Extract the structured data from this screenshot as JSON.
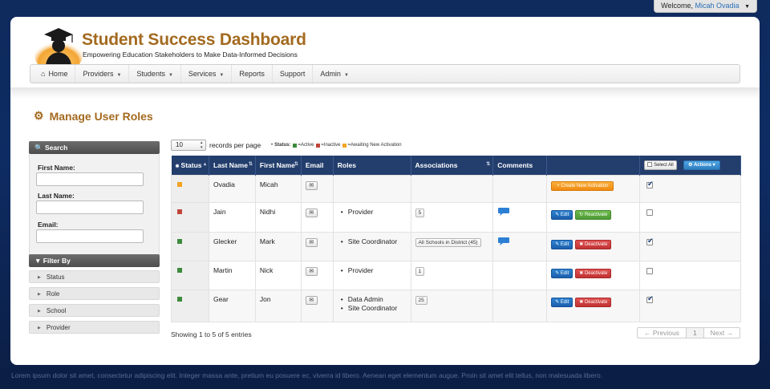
{
  "welcome": {
    "prefix": "Welcome,",
    "user": "Micah Ovadia"
  },
  "header": {
    "title": "Student Success Dashboard",
    "subtitle": "Empowering Education Stakeholders to Make Data-Informed Decisions"
  },
  "nav": {
    "home": "Home",
    "providers": "Providers",
    "students": "Students",
    "services": "Services",
    "reports": "Reports",
    "support": "Support",
    "admin": "Admin"
  },
  "page": {
    "title": "Manage User Roles"
  },
  "search": {
    "title": "Search",
    "first_name_label": "First Name:",
    "last_name_label": "Last Name:",
    "email_label": "Email:",
    "first_name_value": "",
    "last_name_value": "",
    "email_value": ""
  },
  "filter": {
    "title": "Filter By",
    "items": [
      "Status",
      "Role",
      "School",
      "Provider"
    ]
  },
  "controls": {
    "records_value": "10",
    "records_label": "records per page",
    "status_label": "Status:",
    "active_label": "=Active",
    "inactive_label": "=Inactive",
    "awaiting_label": "=Awaiting New Activation"
  },
  "colors": {
    "active": "#3c8a3c",
    "inactive": "#c0463a",
    "awaiting": "#f5a322",
    "accent": "#a36a1f",
    "header_bg": "#233e6d"
  },
  "table": {
    "headers": {
      "status": "Status",
      "last_name": "Last Name",
      "first_name": "First Name",
      "email": "Email",
      "roles": "Roles",
      "associations": "Associations",
      "comments": "Comments",
      "select_all": "Select All",
      "actions": "Actions"
    },
    "rows": [
      {
        "status": "awaiting",
        "last": "Ovadia",
        "first": "Micah",
        "roles": [],
        "assoc": "",
        "comment": false,
        "action": "create",
        "checked": true
      },
      {
        "status": "inactive",
        "last": "Jain",
        "first": "Nidhi",
        "roles": [
          "Provider"
        ],
        "assoc": "5",
        "comment": true,
        "action": "reactivate",
        "checked": false
      },
      {
        "status": "active",
        "last": "Glecker",
        "first": "Mark",
        "roles": [
          "Site Coordinator"
        ],
        "assoc": "All Schools in District (45)",
        "comment": true,
        "action": "deactivate",
        "checked": true
      },
      {
        "status": "active",
        "last": "Martin",
        "first": "Nick",
        "roles": [
          "Provider"
        ],
        "assoc": "1",
        "comment": false,
        "action": "deactivate",
        "checked": false
      },
      {
        "status": "active",
        "last": "Gear",
        "first": "Jon",
        "roles": [
          "Data Admin",
          "Site Coordinator"
        ],
        "assoc": "25",
        "comment": false,
        "action": "deactivate",
        "checked": true
      }
    ],
    "buttons": {
      "create": "Create New Activation",
      "edit": "Edit",
      "reactivate": "Reactivate",
      "deactivate": "Deactivate"
    }
  },
  "pagination": {
    "showing": "Showing 1 to 5 of 5 entries",
    "previous": "← Previous",
    "current": "1",
    "next": "Next →"
  },
  "footer": {
    "text": "Lorem ipsum dolor sit amet, consectetur adipiscing elit. Integer massa ante, pretium eu posuere ec, viverra id libero. Aenean eget elementum augue. Proin sit amet elit tellus, non malesuada libero."
  }
}
